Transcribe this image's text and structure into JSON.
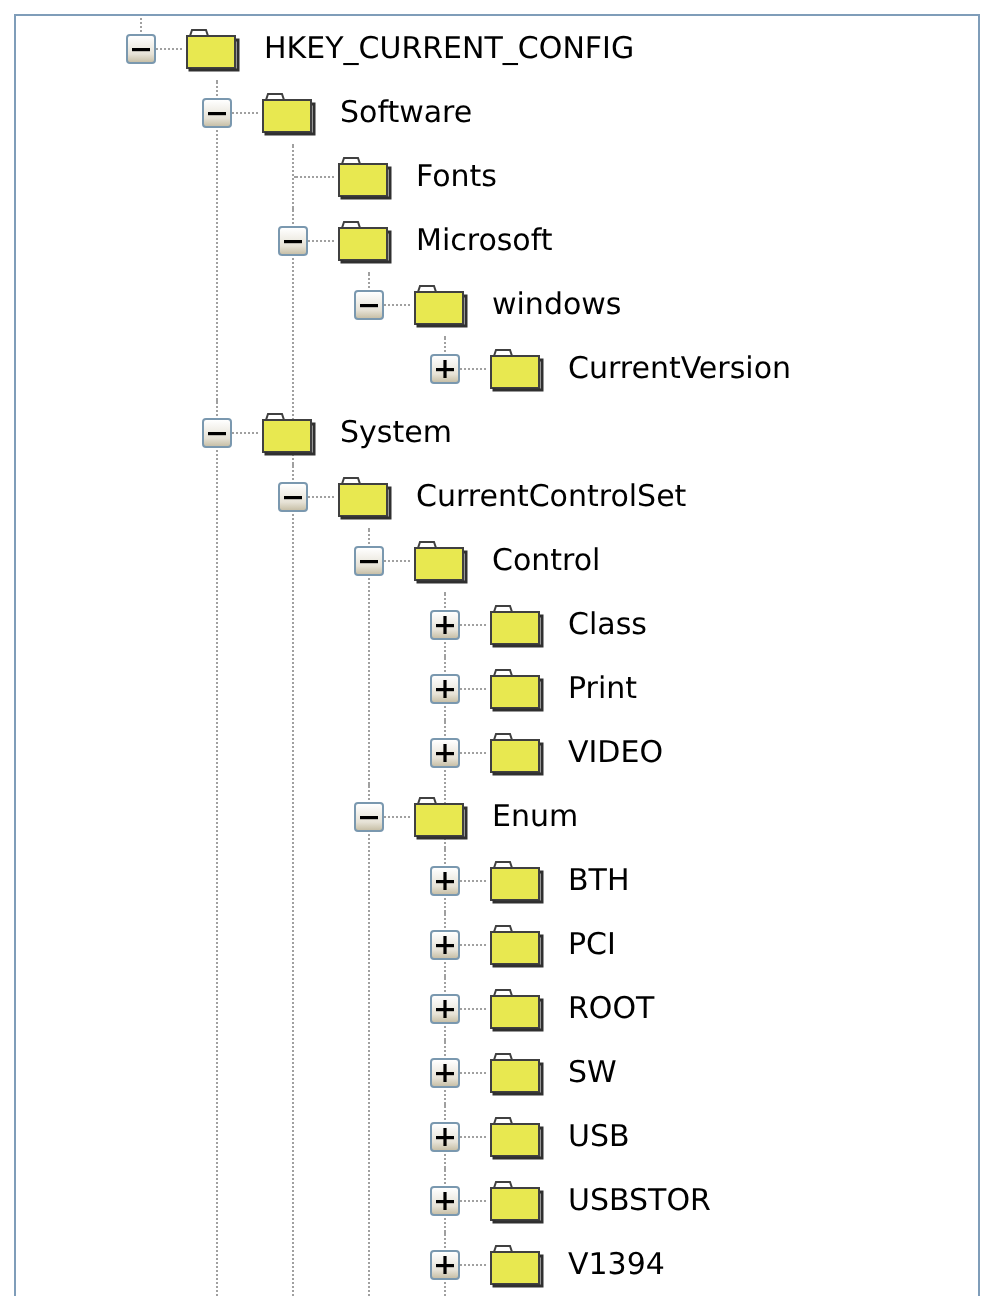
{
  "tree": [
    {
      "label": "HKEY_CURRENT_CONFIG",
      "expandable": true,
      "expanded": true,
      "children": [
        {
          "label": "Software",
          "expandable": true,
          "expanded": true,
          "children": [
            {
              "label": "Fonts",
              "expandable": false,
              "expanded": false
            },
            {
              "label": "Microsoft",
              "expandable": true,
              "expanded": true,
              "children": [
                {
                  "label": "windows",
                  "expandable": true,
                  "expanded": true,
                  "children": [
                    {
                      "label": "CurrentVersion",
                      "expandable": true,
                      "expanded": false
                    }
                  ]
                }
              ]
            }
          ]
        },
        {
          "label": "System",
          "expandable": true,
          "expanded": true,
          "children": [
            {
              "label": "CurrentControlSet",
              "expandable": true,
              "expanded": true,
              "children": [
                {
                  "label": "Control",
                  "expandable": true,
                  "expanded": true,
                  "children": [
                    {
                      "label": "Class",
                      "expandable": true,
                      "expanded": false
                    },
                    {
                      "label": "Print",
                      "expandable": true,
                      "expanded": false
                    },
                    {
                      "label": "VIDEO",
                      "expandable": true,
                      "expanded": false
                    }
                  ]
                },
                {
                  "label": "Enum",
                  "expandable": true,
                  "expanded": true,
                  "children": [
                    {
                      "label": "BTH",
                      "expandable": true,
                      "expanded": false
                    },
                    {
                      "label": "PCI",
                      "expandable": true,
                      "expanded": false
                    },
                    {
                      "label": "ROOT",
                      "expandable": true,
                      "expanded": false
                    },
                    {
                      "label": "SW",
                      "expandable": true,
                      "expanded": false
                    },
                    {
                      "label": "USB",
                      "expandable": true,
                      "expanded": false
                    },
                    {
                      "label": "USBSTOR",
                      "expandable": true,
                      "expanded": false
                    },
                    {
                      "label": "V1394",
                      "expandable": true,
                      "expanded": false
                    }
                  ]
                }
              ]
            }
          ]
        }
      ]
    }
  ]
}
